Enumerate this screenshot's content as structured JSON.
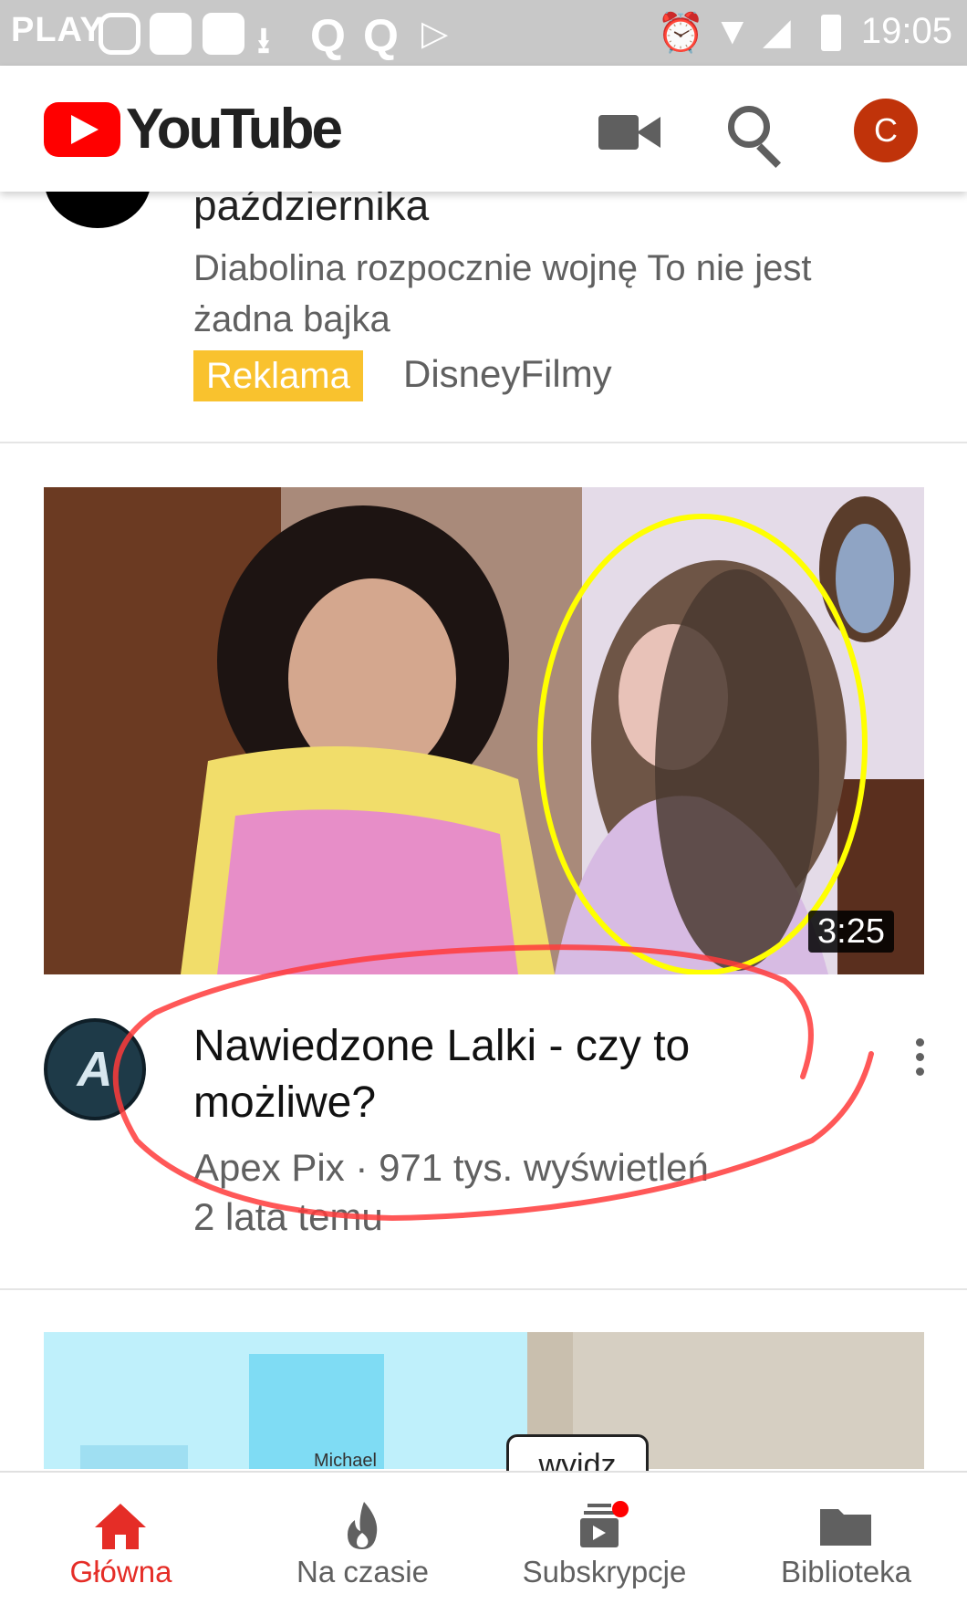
{
  "status_bar": {
    "carrier": "PLAY",
    "time": "19:05",
    "icons": [
      "instagram-icon",
      "cat-app-icon",
      "cat-app-icon",
      "download-icon",
      "q-app-icon",
      "q-app-icon",
      "play-store-icon",
      "alarm-icon",
      "wifi-icon",
      "signal-icon",
      "battery-icon"
    ]
  },
  "app_bar": {
    "logo_text": "YouTube",
    "avatar_letter": "C",
    "icons": [
      "camera-icon",
      "search-icon"
    ],
    "colors": {
      "brand_red": "#ff0000",
      "avatar_bg": "#c0330a"
    }
  },
  "ad_card": {
    "title_partial": "października",
    "description": "Diabolina rozpocznie wojnę To nie jest żadna bajka",
    "badge": "Reklama",
    "channel": "DisneyFilmy",
    "colors": {
      "badge_bg": "#f9c22e"
    }
  },
  "video_card": {
    "duration": "3:25",
    "title": "Nawiedzone Lalki - czy to możliwe?",
    "meta": "Apex Pix · 971 tys. wyświetleń",
    "age": "2 lata temu",
    "channel_avatar_letter": "A"
  },
  "next_card": {
    "thumbnail_text": "wyidz",
    "thumbnail_small_text": "Michael"
  },
  "bottom_nav": {
    "items": [
      {
        "label": "Główna",
        "icon": "home-icon",
        "active": true
      },
      {
        "label": "Na czasie",
        "icon": "flame-icon",
        "active": false
      },
      {
        "label": "Subskrypcje",
        "icon": "subscriptions-icon",
        "active": false
      },
      {
        "label": "Biblioteka",
        "icon": "folder-icon",
        "active": false
      }
    ],
    "colors": {
      "active": "#e52d27",
      "inactive": "#606060"
    }
  }
}
